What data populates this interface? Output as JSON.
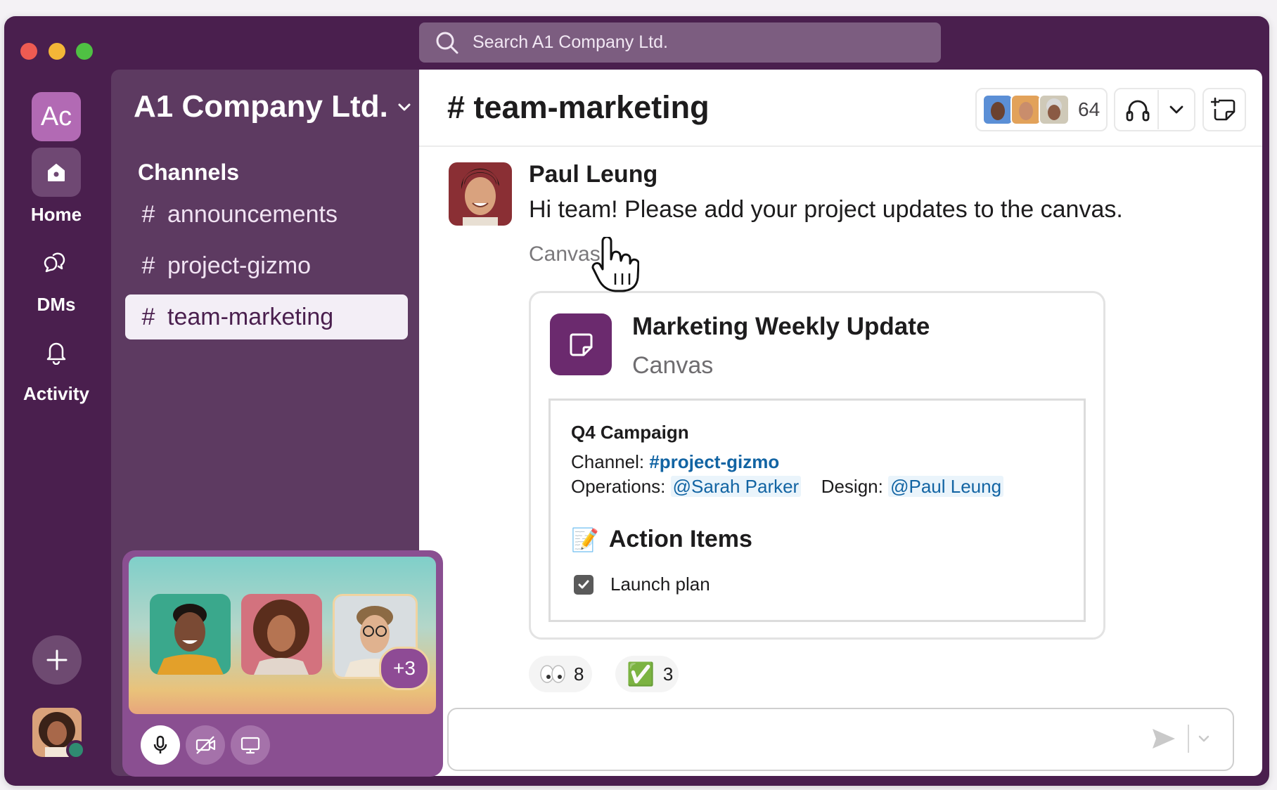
{
  "search": {
    "placeholder": "Search A1 Company Ltd."
  },
  "workspace": {
    "initials": "Ac",
    "name": "A1 Company Ltd."
  },
  "rail": {
    "home": "Home",
    "dms": "DMs",
    "activity": "Activity"
  },
  "sidebar": {
    "section_title": "Channels",
    "channels": [
      {
        "name": "announcements",
        "active": false
      },
      {
        "name": "project-gizmo",
        "active": false
      },
      {
        "name": "team-marketing",
        "active": true
      }
    ]
  },
  "huddle": {
    "extra_count": "+3"
  },
  "channel": {
    "title": "# team-marketing",
    "member_count": "64"
  },
  "message": {
    "author": "Paul Leung",
    "text": "Hi team! Please add your project updates to the canvas.",
    "attachment_label": "Canvas"
  },
  "canvas": {
    "title": "Marketing Weekly Update",
    "subtitle": "Canvas",
    "heading": "Q4 Campaign",
    "channel_label": "Channel:",
    "channel_link": "#project-gizmo",
    "operations_label": "Operations:",
    "operations_mention": "@Sarah Parker",
    "design_label": "Design:",
    "design_mention": "@Paul Leung",
    "action_items_title": "Action Items",
    "todo_item": "Launch plan",
    "todo_checked": true
  },
  "reactions": [
    {
      "emoji": "eyes",
      "count": "8"
    },
    {
      "emoji": "✅",
      "count": "3"
    }
  ],
  "colors": {
    "aubergine": "#4a1f4e",
    "sidebar": "#5d3a61",
    "link": "#1264a3",
    "canvas_icon": "#6b2a6e"
  }
}
